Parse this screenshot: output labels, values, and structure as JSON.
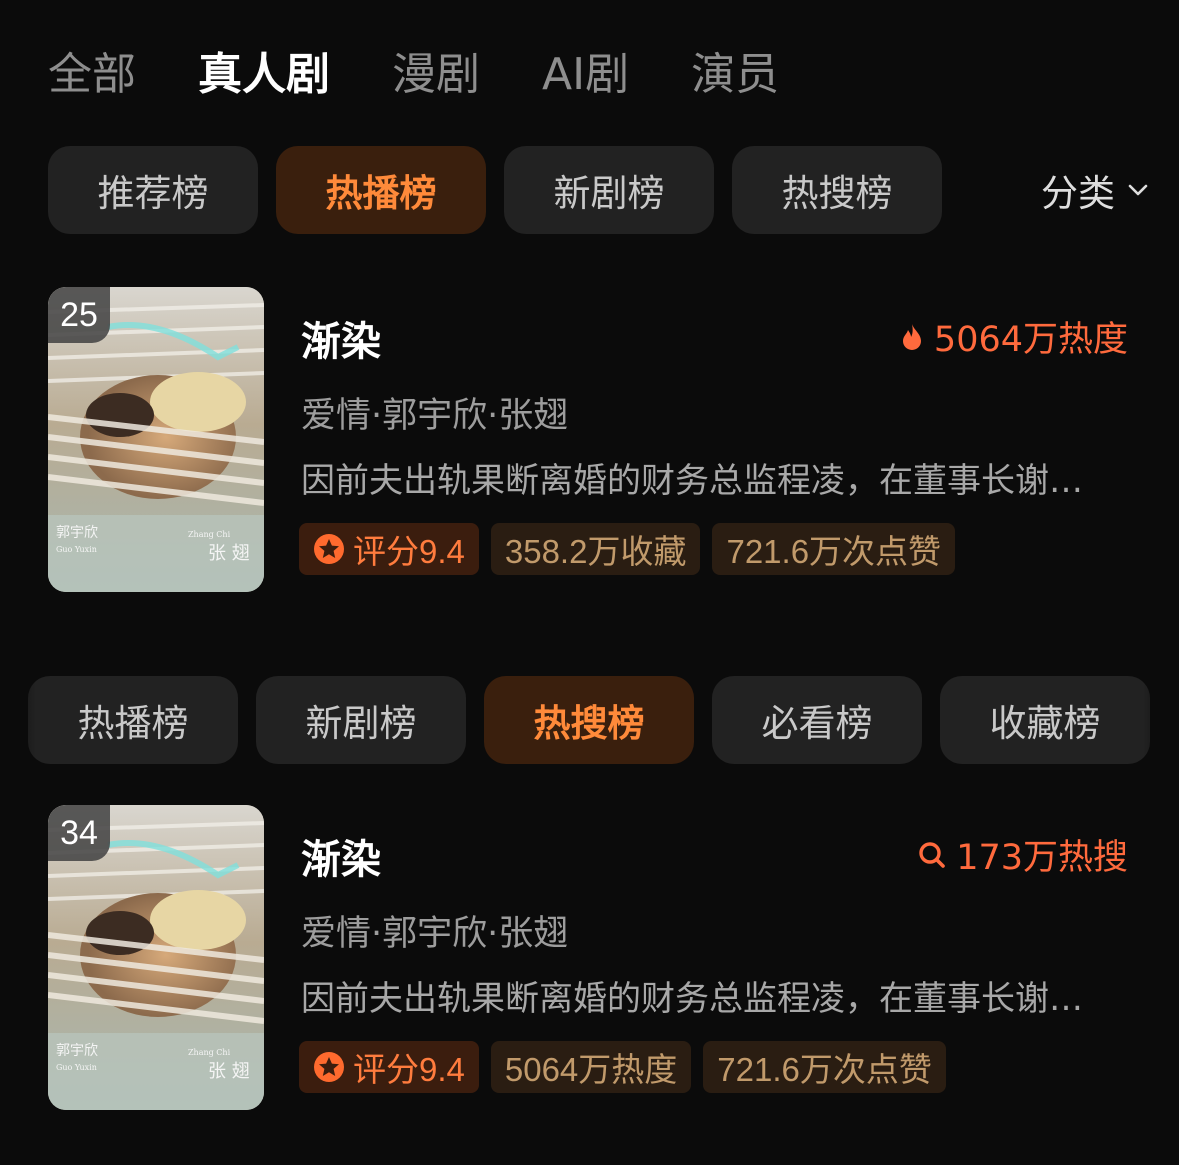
{
  "top_tabs": [
    "全部",
    "真人剧",
    "漫剧",
    "AI剧",
    "演员"
  ],
  "top_tabs_active_index": 1,
  "pill_row_1": {
    "items": [
      "推荐榜",
      "热播榜",
      "新剧榜",
      "热搜榜"
    ],
    "active_index": 1,
    "category_label": "分类"
  },
  "pill_row_2": {
    "items": [
      "热播榜",
      "新剧榜",
      "热搜榜",
      "必看榜",
      "收藏榜"
    ],
    "active_index": 2
  },
  "cards": [
    {
      "rank": "25",
      "title": "渐染",
      "heat_icon": "flame-icon",
      "heat_text": "5064万热度",
      "meta": "爱情·郭宇欣·张翅",
      "desc": "因前夫出轨果断离婚的财务总监程凌，在董事长谢…",
      "score": "评分9.4",
      "stat1": "358.2万收藏",
      "stat2": "721.6万次点赞"
    },
    {
      "rank": "34",
      "title": "渐染",
      "heat_icon": "search-icon",
      "heat_text": "173万热搜",
      "meta": "爱情·郭宇欣·张翅",
      "desc": "因前夫出轨果断离婚的财务总监程凌，在董事长谢…",
      "score": "评分9.4",
      "stat1": "5064万热度",
      "stat2": "721.6万次点赞"
    }
  ],
  "poster_text": {
    "cn_name_left": "郭宇欣",
    "en_name_left": "Guo Yuxin",
    "en_name_right": "Zhang Chi",
    "cn_name_right": "张 翅"
  },
  "colors": {
    "background": "#0b0b0b",
    "accent_orange": "#ff6a3d",
    "active_pill_bg": "#3a1f0d",
    "chip_bg": "#2a1d12"
  }
}
